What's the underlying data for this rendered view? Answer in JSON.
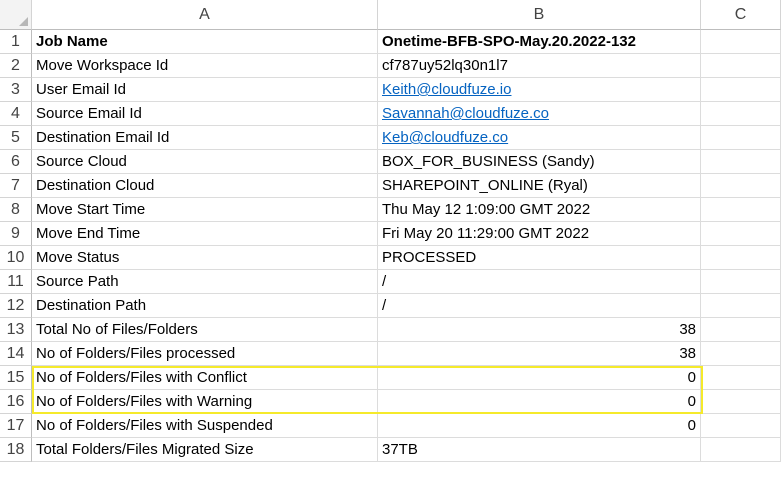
{
  "columns": [
    "A",
    "B",
    "C"
  ],
  "rows": [
    {
      "num": "1",
      "a": "Job Name",
      "b": "Onetime-BFB-SPO-May.20.2022-132",
      "bold": true
    },
    {
      "num": "2",
      "a": "Move Workspace Id",
      "b": "cf787uy52lq30n1l7"
    },
    {
      "num": "3",
      "a": "User Email Id",
      "b": "Keith@cloudfuze.io",
      "link": true
    },
    {
      "num": "4",
      "a": "Source Email Id",
      "b": "Savannah@cloudfuze.co",
      "link": true
    },
    {
      "num": "5",
      "a": "Destination Email Id",
      "b": "Keb@cloudfuze.co",
      "link": true
    },
    {
      "num": "6",
      "a": "Source Cloud",
      "b": "BOX_FOR_BUSINESS (Sandy)"
    },
    {
      "num": "7",
      "a": "Destination Cloud",
      "b": "SHAREPOINT_ONLINE (Ryal)"
    },
    {
      "num": "8",
      "a": "Move Start Time",
      "b": "Thu May 12 1:09:00 GMT 2022"
    },
    {
      "num": "9",
      "a": "Move End Time",
      "b": "Fri May 20 11:29:00 GMT 2022"
    },
    {
      "num": "10",
      "a": "Move Status",
      "b": "PROCESSED"
    },
    {
      "num": "11",
      "a": "Source Path",
      "b": "/"
    },
    {
      "num": "12",
      "a": "Destination Path",
      "b": "/"
    },
    {
      "num": "13",
      "a": "Total No of Files/Folders",
      "b": "38",
      "numeric": true
    },
    {
      "num": "14",
      "a": "No of Folders/Files processed",
      "b": "38",
      "numeric": true
    },
    {
      "num": "15",
      "a": "No of Folders/Files with Conflict",
      "b": "0",
      "numeric": true
    },
    {
      "num": "16",
      "a": "No of Folders/Files with Warning",
      "b": "0",
      "numeric": true
    },
    {
      "num": "17",
      "a": "No of Folders/Files with Suspended",
      "b": "0",
      "numeric": true
    },
    {
      "num": "18",
      "a": "Total Folders/Files Migrated Size",
      "b": "37TB"
    }
  ],
  "highlight_color": "#f5ea2b",
  "link_color": "#0563c1"
}
